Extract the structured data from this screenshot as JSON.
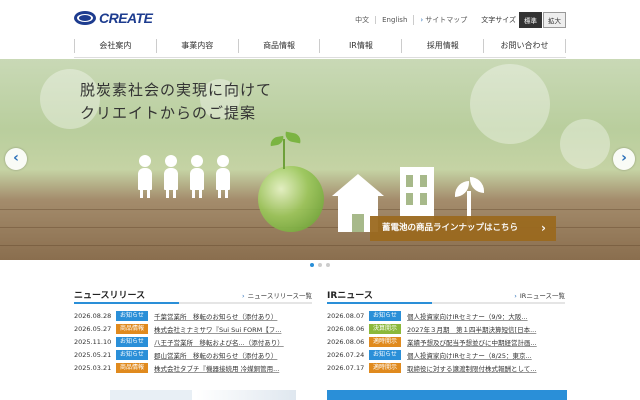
{
  "header": {
    "logo_text": "CREATE",
    "links": [
      "中文",
      "English",
      "サイトマップ"
    ],
    "font_size_label": "文字サイズ",
    "font_size_options": [
      {
        "label": "標準",
        "active": true
      },
      {
        "label": "拡大",
        "active": false
      }
    ]
  },
  "nav": {
    "items": [
      "会社案内",
      "事業内容",
      "商品情報",
      "IR情報",
      "採用情報",
      "お問い合わせ"
    ]
  },
  "hero": {
    "title_line1": "脱炭素社会の実現に向けて",
    "title_line2": "クリエイトからのご提案",
    "banner_label": "蓄電池の商品ラインナップはこちら",
    "prev_icon": "chevron-left-icon",
    "next_icon": "chevron-right-icon",
    "slide_count": 3,
    "active_slide": 1
  },
  "news": {
    "title": "ニュースリリース",
    "more_label": "ニュースリリース一覧",
    "items": [
      {
        "date": "2026.08.28",
        "tag": "お知らせ",
        "title": "千葉営業所　移転のお知らせ（添付あり）"
      },
      {
        "date": "2026.05.27",
        "tag": "商品情報",
        "title": "株式会社ミナミサワ『Sui Sui FORM【フ..."
      },
      {
        "date": "2025.11.10",
        "tag": "お知らせ",
        "title": "八王子営業所　移転および名...（添付あり）"
      },
      {
        "date": "2025.05.21",
        "tag": "お知らせ",
        "title": "郡山営業所　移転のお知らせ（添付あり）"
      },
      {
        "date": "2025.03.21",
        "tag": "商品情報",
        "title": "株式会社タブチ『機器接続用 冷媒銅管用..."
      }
    ]
  },
  "ir": {
    "title": "IRニュース",
    "more_label": "IRニュース一覧",
    "items": [
      {
        "date": "2026.08.07",
        "tag": "お知らせ",
        "title": "個人投資家向けIRセミナー（9/9：大阪..."
      },
      {
        "date": "2026.08.06",
        "tag": "決算開示",
        "title": "2027年３月期　第１四半期決算短信[日本..."
      },
      {
        "date": "2026.08.06",
        "tag": "適時開示",
        "title": "業績予想及び配当予想並びに中期経営計画..."
      },
      {
        "date": "2026.07.24",
        "tag": "お知らせ",
        "title": "個人投資家向けIRセミナー（8/25：東京..."
      },
      {
        "date": "2026.07.17",
        "tag": "適時開示",
        "title": "取締役に対する譲渡制限付株式報酬として..."
      }
    ]
  },
  "colors": {
    "brand": "#1d3c8f",
    "accent": "#2a8fd8",
    "tag_notice": "#2a8fd8",
    "tag_product": "#e08a1e",
    "tag_results": "#8bb83a",
    "tag_timely": "#e08a1e",
    "banner": "#9b6a1f"
  }
}
